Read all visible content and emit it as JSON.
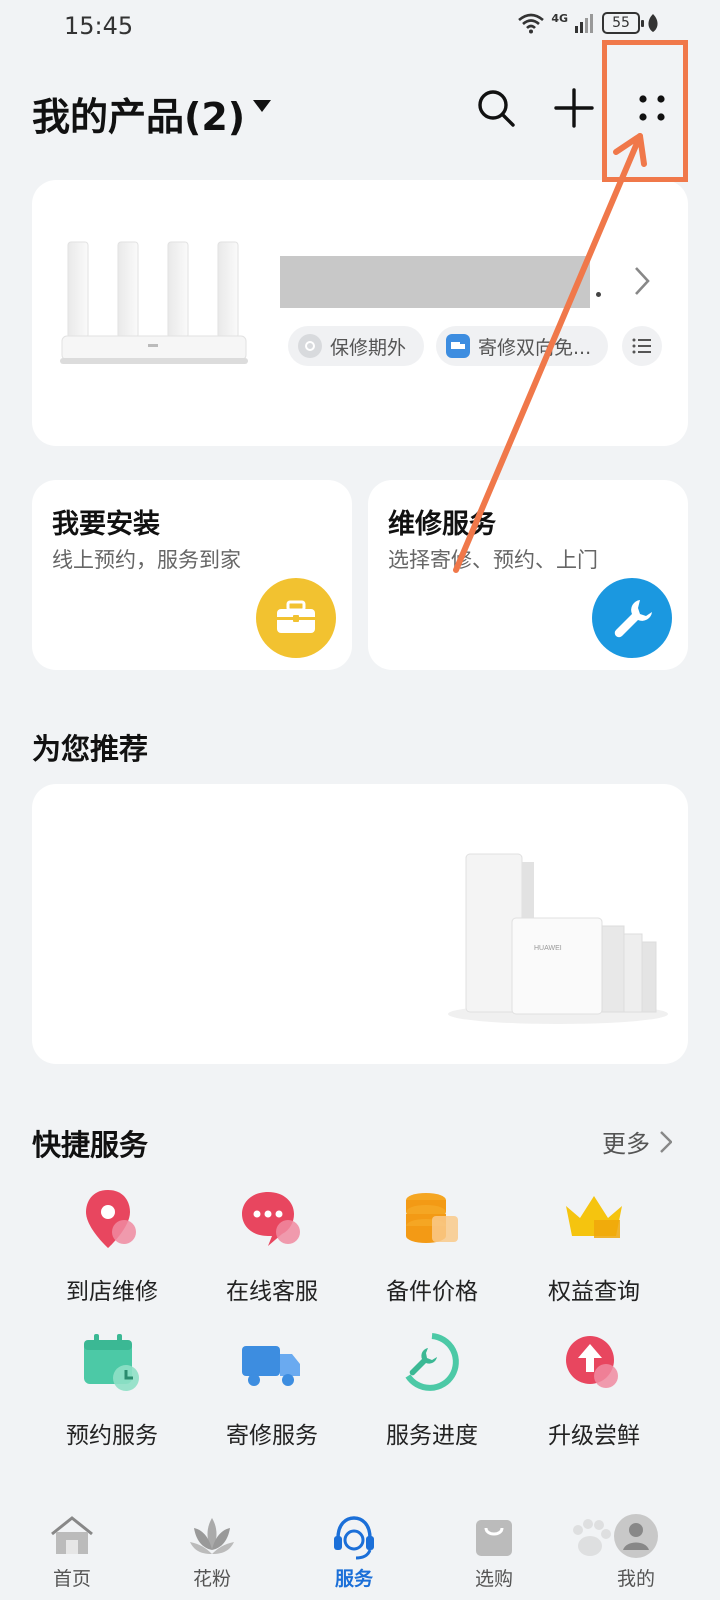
{
  "status_bar": {
    "time": "15:45",
    "network": "4G",
    "battery": "55"
  },
  "header": {
    "title": "我的产品(2)",
    "icons": [
      "search-icon",
      "add-icon",
      "more-grid-icon"
    ]
  },
  "product_card": {
    "tags": [
      "保修期外",
      "寄修双向免..."
    ],
    "tag_icons": [
      "shield-icon",
      "truck-icon",
      "list-icon"
    ]
  },
  "services": [
    {
      "title": "我要安装",
      "subtitle": "线上预约，服务到家",
      "icon": "toolbox-icon",
      "color": "#f2c230"
    },
    {
      "title": "维修服务",
      "subtitle": "选择寄修、预约、上门",
      "icon": "wrench-icon",
      "color": "#1b98e0"
    }
  ],
  "recommend": {
    "title": "为您推荐",
    "brand": "HUAWEI"
  },
  "quick_services": {
    "title": "快捷服务",
    "more": "更多",
    "items": [
      {
        "label": "到店维修",
        "icon": "location-pin-icon"
      },
      {
        "label": "在线客服",
        "icon": "chat-bubble-icon"
      },
      {
        "label": "备件价格",
        "icon": "coin-stack-icon"
      },
      {
        "label": "权益查询",
        "icon": "crown-icon"
      },
      {
        "label": "预约服务",
        "icon": "calendar-clock-icon"
      },
      {
        "label": "寄修服务",
        "icon": "delivery-truck-icon"
      },
      {
        "label": "服务进度",
        "icon": "progress-wrench-icon"
      },
      {
        "label": "升级尝鲜",
        "icon": "upgrade-arrow-icon"
      }
    ]
  },
  "tab_bar": {
    "tabs": [
      {
        "label": "首页",
        "icon": "home-icon"
      },
      {
        "label": "花粉",
        "icon": "lotus-icon"
      },
      {
        "label": "服务",
        "icon": "headset-icon",
        "active": true
      },
      {
        "label": "选购",
        "icon": "shopping-bag-icon"
      },
      {
        "label": "我的",
        "icon": "avatar-icon"
      }
    ]
  },
  "colors": {
    "accent_blue": "#1b6fd8",
    "annotation_orange": "#f0784a",
    "background": "#f1f3f5"
  }
}
